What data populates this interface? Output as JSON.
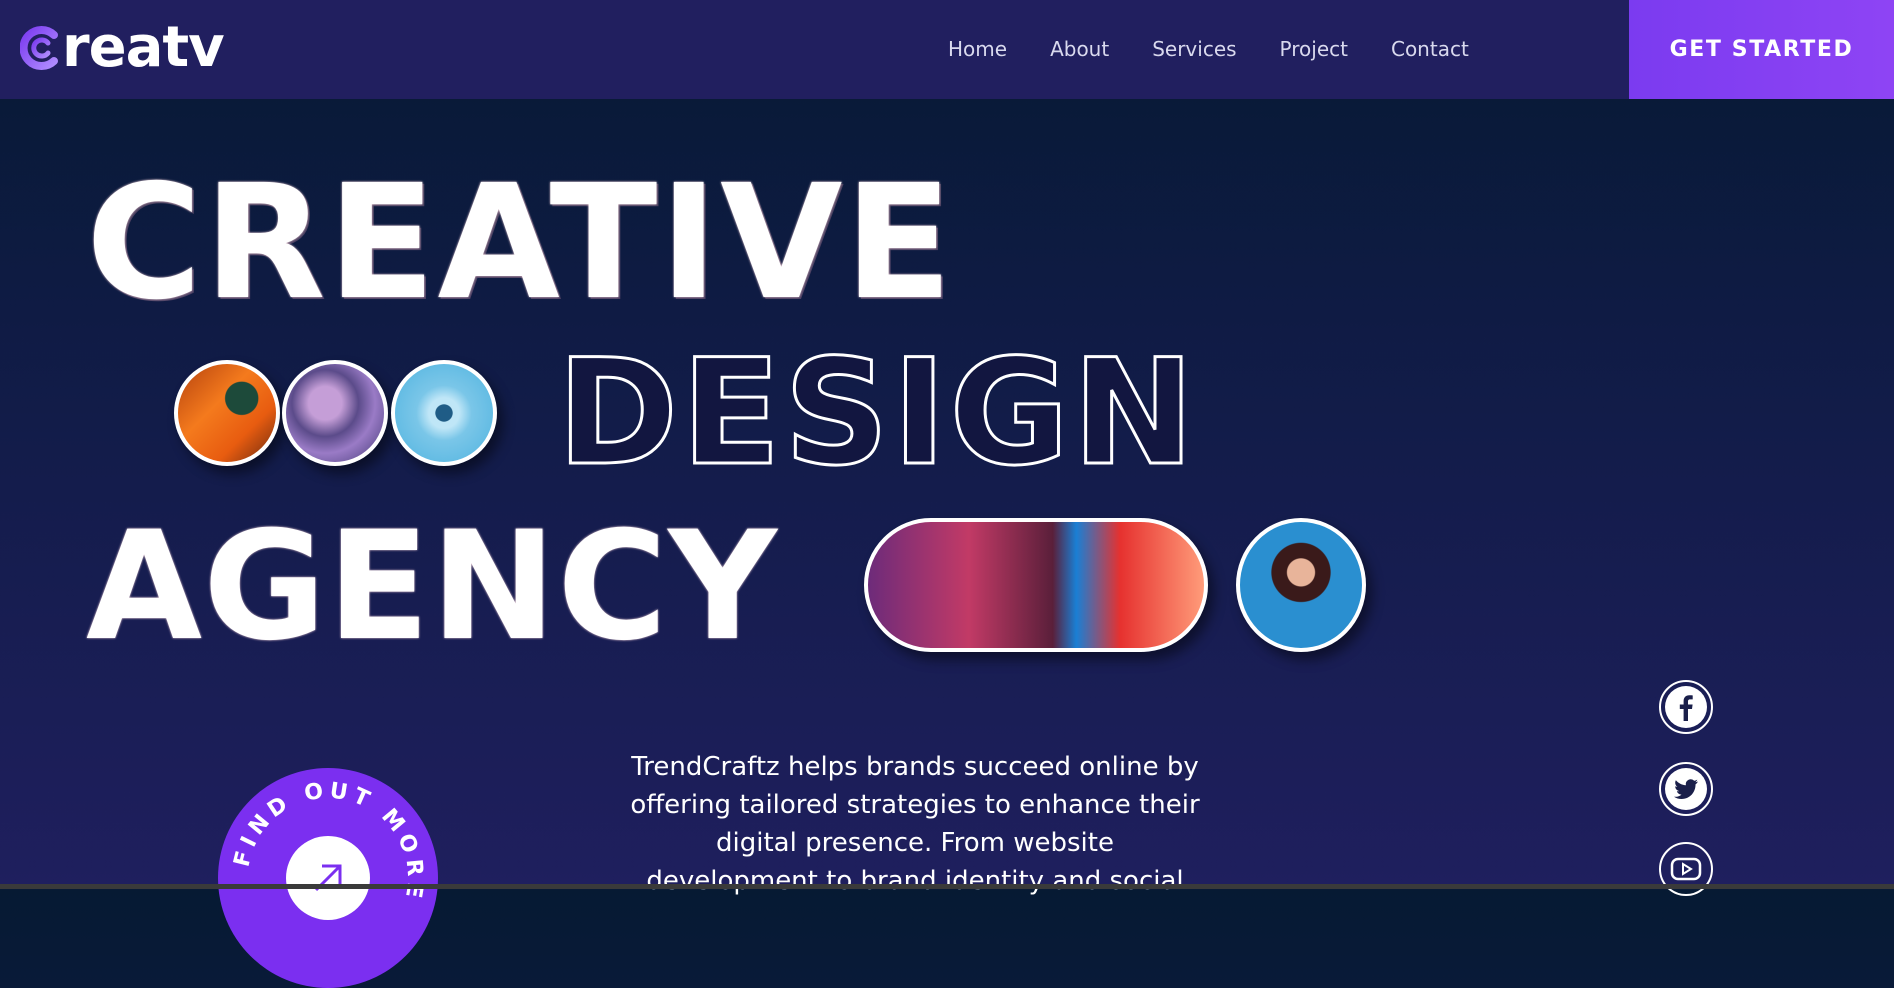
{
  "nav": {
    "logo_text": "reatv",
    "menu": [
      "Home",
      "About",
      "Services",
      "Project",
      "Contact"
    ],
    "cta_label": "GET STARTED"
  },
  "hero": {
    "line1": "CREATIVE",
    "line2": "DESIGN",
    "line3": "AGENCY",
    "description": "TrendCraftz helps brands succeed online by offering tailored strategies to enhance their digital presence. From website development to brand identity and social",
    "badge_text": "FIND OUT MORE"
  },
  "social": [
    "facebook-icon",
    "twitter-icon",
    "youtube-icon"
  ],
  "colors": {
    "nav_bg": "#211f5f",
    "accent": "#8e44f4",
    "text": "#ffffff"
  }
}
